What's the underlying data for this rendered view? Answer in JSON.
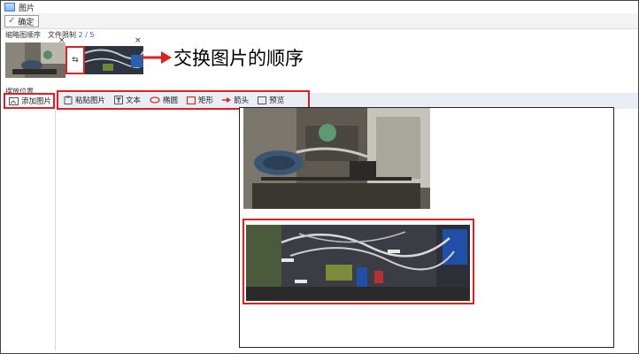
{
  "window": {
    "title": "图片"
  },
  "toolbar_top": {
    "ok_label": "确定"
  },
  "thumbnails": {
    "order_label": "缩略图顺序",
    "limit_label": "文件限制",
    "count": "2 / 5",
    "close_glyph": "×",
    "swap_glyph": "⇆"
  },
  "annotation": {
    "text": "交换图片的顺序"
  },
  "placement": {
    "label": "摆放位置",
    "add_image_label": "添加图片"
  },
  "tools": {
    "paste_label": "粘贴图片",
    "text_label": "文本",
    "ellipse_label": "椭圆",
    "rect_label": "矩形",
    "arrow_label": "箭头",
    "preview_label": "预览"
  },
  "colors": {
    "highlight": "#e02020",
    "toolbar_bg": "#e9eef5",
    "accent_blue": "#3a5fcd"
  }
}
